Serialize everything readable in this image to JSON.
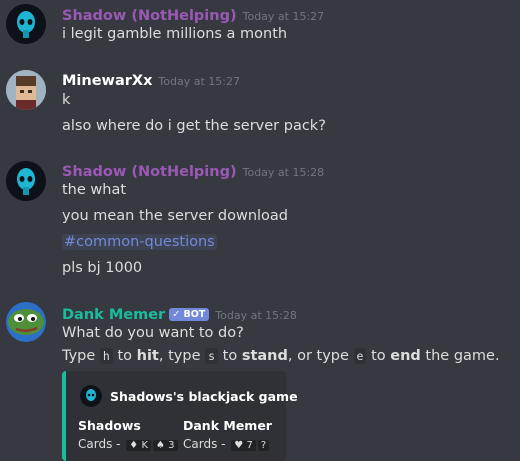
{
  "messages": [
    {
      "author": "Shadow (NotHelping)",
      "author_color": "#9b59b6",
      "timestamp": "Today at 15:27",
      "lines": [
        "i legit gamble millions a month"
      ]
    },
    {
      "author": "MinewarXx",
      "author_color": "#ffffff",
      "timestamp": "Today at 15:27",
      "lines": [
        "k",
        "also where do i get the server pack?"
      ]
    },
    {
      "author": "Shadow (NotHelping)",
      "author_color": "#9b59b6",
      "timestamp": "Today at 15:28",
      "lines": [
        "the what",
        "you mean the server download",
        "#common-questions",
        "pls bj 1000"
      ]
    },
    {
      "author": "Dank Memer",
      "author_color": "#1abc9c",
      "bot_tag": "BOT",
      "bot_check": "✓",
      "timestamp": "Today at 15:28",
      "lines": [
        "What do you want to do?"
      ],
      "instruction": {
        "type1": "Type ",
        "key_h": "h",
        "to1": " to ",
        "hit": "hit",
        "type2": ", type ",
        "key_s": "s",
        "to2": " to ",
        "stand": "stand",
        "or": ", or type ",
        "key_e": "e",
        "to3": " to ",
        "end": "end",
        "tail": " the game."
      },
      "embed": {
        "accent": "#1abc9c",
        "title": "Shadows's blackjack game",
        "fields": [
          {
            "name": "Shadows",
            "label": "Cards - ",
            "cards": [
              "♦ K",
              "♠ 3"
            ]
          },
          {
            "name": "Dank Memer",
            "label": "Cards - ",
            "cards": [
              "♥ 7",
              "?"
            ]
          }
        ]
      }
    }
  ]
}
